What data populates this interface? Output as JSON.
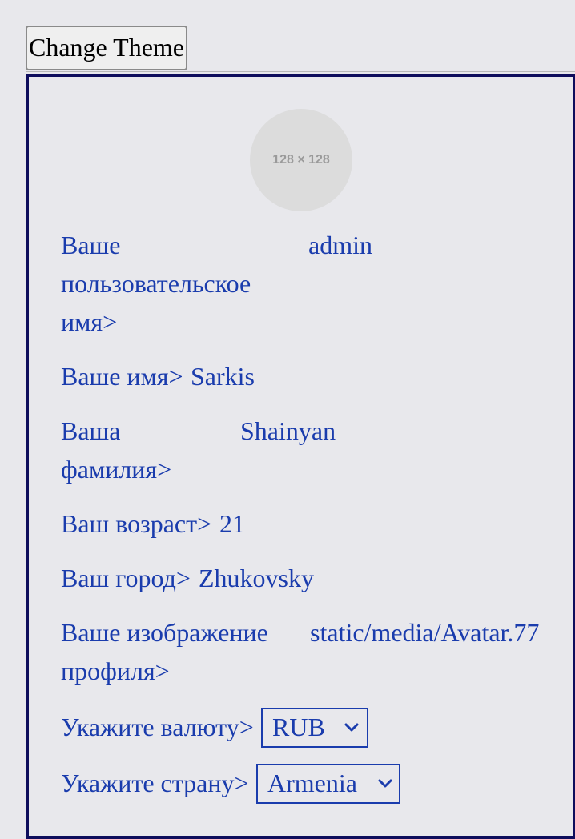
{
  "toolbar": {
    "change_theme_label": "Change Theme"
  },
  "avatar": {
    "placeholder_text": "128 × 128"
  },
  "profile": {
    "username": {
      "label_line1": "Ваше",
      "label_line2": "пользовательское",
      "label_line3": "имя>",
      "value": "admin"
    },
    "first_name": {
      "label": "Ваше имя>",
      "value": "Sarkis"
    },
    "last_name": {
      "label_line1": "Ваша",
      "label_line2": "фамилия>",
      "value": "Shainyan"
    },
    "age": {
      "label": "Ваш возраст>",
      "value": "21"
    },
    "city": {
      "label": "Ваш город>",
      "value": "Zhukovsky"
    },
    "image": {
      "label_line1": "Ваше изображение",
      "label_line2": "профиля>",
      "value": "static/media/Avatar.77"
    },
    "currency": {
      "label": "Укажите валюту>",
      "selected": "RUB"
    },
    "country": {
      "label": "Укажите страну>",
      "selected": "Armenia"
    }
  },
  "colors": {
    "text_blue": "#1a3cad",
    "panel_border": "#0e0d5c",
    "background": "#e8e8ec"
  }
}
